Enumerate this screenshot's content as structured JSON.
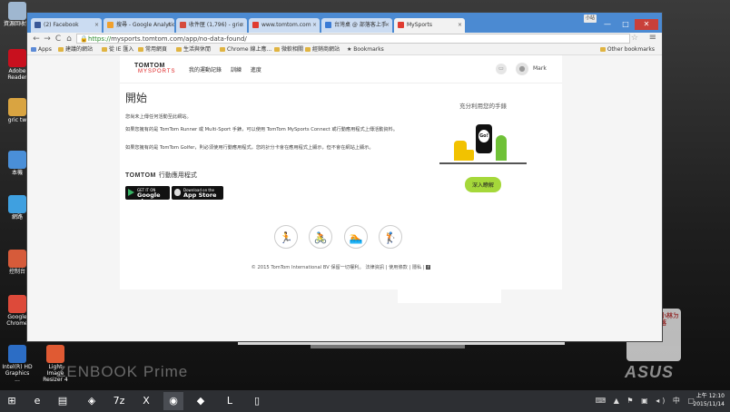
{
  "desktop": {
    "icons": [
      {
        "label": "資源回收筒",
        "color": "#9fb7d0"
      },
      {
        "label": "Adobe Reader",
        "color": "#c8101e"
      },
      {
        "label": "gric tw",
        "color": "#d9a441"
      },
      {
        "label": "本機",
        "color": "#4a8fd8"
      },
      {
        "label": "網路",
        "color": "#3fa0e0"
      },
      {
        "label": "控制台",
        "color": "#d65b3a"
      },
      {
        "label": "Google Chrome",
        "color": "#dd4a3a"
      },
      {
        "label": "Intel(R) HD Graphics ...",
        "color": "#2c6dc5"
      },
      {
        "label": "Light Image Resizer 4",
        "color": "#e05a33"
      }
    ],
    "brand_left": "ZENBOOK Prime",
    "brand_right": "ASUS",
    "watermark_text": "小小林ㄉ部落"
  },
  "browser": {
    "tabs": [
      {
        "title": "(2) Facebook",
        "favicon_color": "#3b5998",
        "active": false
      },
      {
        "title": "搜尋 - Google Analytics",
        "favicon_color": "#f0a02d",
        "active": false
      },
      {
        "title": "收件匣 (1,796) - gric",
        "favicon_color": "#d54b3d",
        "active": false
      },
      {
        "title": "www.tomtom.com",
        "favicon_color": "#e03c31",
        "active": false
      },
      {
        "title": "台灣桌 @ 部落客上手",
        "favicon_color": "#3a7bd5",
        "active": false
      },
      {
        "title": "MySports",
        "favicon_color": "#e03c31",
        "active": true
      }
    ],
    "profile_badge": "小站",
    "window_controls": {
      "minimize": "—",
      "maximize": "□",
      "close": "✕"
    },
    "nav": {
      "back": "←",
      "forward": "→",
      "reload": "C",
      "home": "⌂"
    },
    "url_scheme": "https://",
    "url_rest": "mysports.tomtom.com/app/no-data-found/",
    "bookmarks": [
      {
        "label": "Apps",
        "kind": "apps"
      },
      {
        "label": "建議的網站",
        "kind": "folder"
      },
      {
        "label": "從 IE 匯入",
        "kind": "folder"
      },
      {
        "label": "常用網頁",
        "kind": "folder"
      },
      {
        "label": "生活與休閒",
        "kind": "folder"
      },
      {
        "label": "Chrome 線上應...",
        "kind": "folder"
      },
      {
        "label": "微軟相關",
        "kind": "folder"
      },
      {
        "label": "經銷商網站",
        "kind": "folder"
      },
      {
        "label": "★ Bookmarks",
        "kind": "plain"
      }
    ],
    "other_bookmarks": "Other bookmarks"
  },
  "site": {
    "logo_main": "TOMTOM",
    "logo_sub": "MYSPORTS",
    "nav_links": [
      "我的運動記錄",
      "訓練",
      "進度"
    ],
    "user_name": "Mark",
    "page_title": "開始",
    "paragraphs": [
      "您尚未上傳任何活動至此網站。",
      "如果您擁有的是 TomTom Runner 或 Multi-Sport 手錶，可以使用 TomTom MySports Connect 或行動應用程式上傳活動資料。",
      "如果您擁有的是 TomTom Golfer，則必須使用行動應用程式，您的計分卡會在應用程式上顯示，但不會在網站上顯示。"
    ],
    "apps_title_brand": "TOMTOM",
    "apps_title_rest": "行動應用程式",
    "google_play": {
      "small": "GET IT ON",
      "big": "Google play"
    },
    "app_store": {
      "small": "Download on the",
      "big": "App Store"
    },
    "promo_title": "充分利用您的手錶",
    "promo_watch_text": "Go!",
    "learn_more": "深入瞭解",
    "sport_icons": [
      "running-icon",
      "cycling-icon",
      "swimming-icon",
      "golf-icon"
    ],
    "sport_glyphs": [
      "🏃",
      "🚴",
      "🏊",
      "🏌"
    ],
    "footer": "© 2015 TomTom International BV 保留一切權利。 法律資訊 | 使用條款 | 隱私 |"
  },
  "taskbar": {
    "items": [
      "start-icon",
      "ie-icon",
      "explorer-icon",
      "network-icon",
      "7z-icon",
      "excel-icon",
      "chrome-icon",
      "app-icon",
      "line-icon",
      "phone-icon"
    ],
    "glyphs": [
      "⊞",
      "e",
      "▤",
      "◈",
      "7z",
      "X",
      "◉",
      "◆",
      "L",
      "▯"
    ],
    "tray_glyphs": "⌨ ▲ ⚑ ▣ ◂) 中 ▢",
    "time": "上午 12:10",
    "date": "2015/11/14"
  }
}
